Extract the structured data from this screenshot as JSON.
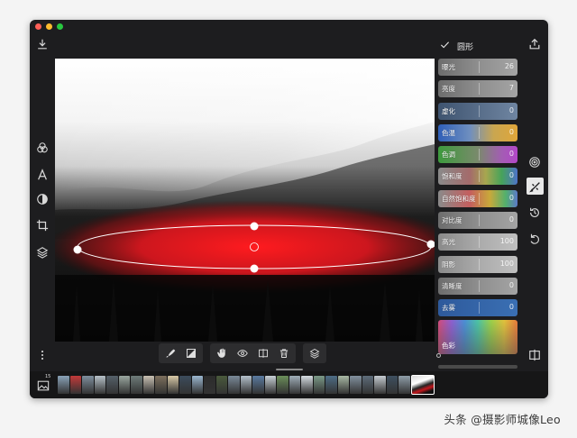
{
  "panel": {
    "title": "圆形",
    "sliders": [
      {
        "key": "exposure",
        "label": "曝光",
        "value": "26",
        "style": "s-gray"
      },
      {
        "key": "brightness",
        "label": "亮度",
        "value": "7",
        "style": "s-gray"
      },
      {
        "key": "blur",
        "label": "虚化",
        "value": "0",
        "style": "s-blur"
      },
      {
        "key": "temperature",
        "label": "色温",
        "value": "0",
        "style": "s-temp"
      },
      {
        "key": "tint",
        "label": "色调",
        "value": "0",
        "style": "s-tint"
      },
      {
        "key": "saturation",
        "label": "饱和度",
        "value": "0",
        "style": "s-sat"
      },
      {
        "key": "vibrance",
        "label": "自然饱和度",
        "value": "0",
        "style": "s-vib"
      },
      {
        "key": "contrast",
        "label": "对比度",
        "value": "0",
        "style": "s-gray"
      },
      {
        "key": "highlights",
        "label": "高光",
        "value": "100",
        "style": "s-gray-light"
      },
      {
        "key": "shadows",
        "label": "阴影",
        "value": "100",
        "style": "s-gray-light"
      },
      {
        "key": "clarity",
        "label": "清晰度",
        "value": "0",
        "style": "s-gray"
      },
      {
        "key": "dehaze",
        "label": "去雾",
        "value": "0",
        "style": "s-dehaze"
      }
    ],
    "color_label": "色彩"
  },
  "filmstrip": {
    "count": "15",
    "thumb_colors": [
      "#8aa3b8",
      "#c33a3a",
      "#7e8f9e",
      "#b7c2c9",
      "#556069",
      "#9aa7a0",
      "#6e7c7a",
      "#c9c1b3",
      "#7d6f5d",
      "#d8c9a7",
      "#3c4c5c",
      "#9bb7d0",
      "#2c2c2c",
      "#4a5a3c",
      "#7a8a99",
      "#b4c1cc",
      "#5a7aa0",
      "#c7d0d6",
      "#6b8f5a",
      "#a0aeb8",
      "#d6dde3",
      "#7b9a88",
      "#4e6d86",
      "#a9b9a5",
      "#82919f",
      "#5d6c7a",
      "#c5ccd2",
      "#3e5060",
      "#8f9ea9"
    ]
  },
  "watermark": "头条 @摄影师城像Leo",
  "colors": {
    "accent_red": "#e0161e",
    "window_bg": "#1d1d1f"
  },
  "icons": {
    "left": [
      "download-icon",
      "color-filter-icon",
      "text-icon",
      "mask-icon",
      "crop-icon",
      "layers-icon",
      "more-icon"
    ],
    "right": [
      "share-icon",
      "radial-filter-icon",
      "brush-off-icon",
      "history-icon",
      "undo-icon",
      "compare-icon"
    ],
    "toolbar": [
      "brush-icon",
      "gradient-icon",
      "hand-icon",
      "eye-icon",
      "split-view-icon",
      "trash-icon",
      "layers-icon"
    ]
  }
}
